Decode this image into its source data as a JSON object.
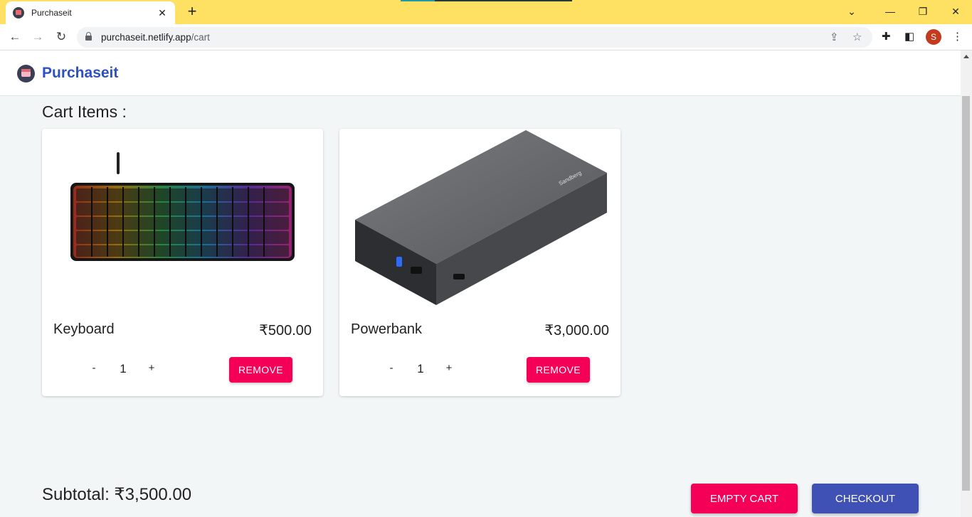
{
  "browser": {
    "tab_title": "Purchaseit",
    "url_host": "purchaseit.netlify.app",
    "url_path": "/cart",
    "profile_initial": "S",
    "accent_color": "#fee063"
  },
  "app": {
    "brand": "Purchaseit",
    "brand_color": "#2f4fc4"
  },
  "cart": {
    "heading": "Cart Items :",
    "items": [
      {
        "name": "Keyboard",
        "price": "₹500.00",
        "quantity": "1",
        "minus_label": "-",
        "plus_label": "+",
        "remove_label": "REMOVE"
      },
      {
        "name": "Powerbank",
        "price": "₹3,000.00",
        "quantity": "1",
        "minus_label": "-",
        "plus_label": "+",
        "remove_label": "REMOVE"
      }
    ],
    "subtotal": "Subtotal: ₹3,500.00",
    "empty_cart_label": "EMPTY CART",
    "checkout_label": "CHECKOUT",
    "colors": {
      "danger": "#f50057",
      "primary": "#3f51b5"
    }
  },
  "icons": [
    "back-icon",
    "forward-icon",
    "reload-icon",
    "lock-icon",
    "share-icon",
    "star-icon",
    "extensions-icon",
    "side-panel-icon",
    "menu-icon",
    "close-icon",
    "new-tab-icon",
    "tab-search-icon",
    "minimize-icon",
    "restore-icon",
    "window-close-icon"
  ]
}
